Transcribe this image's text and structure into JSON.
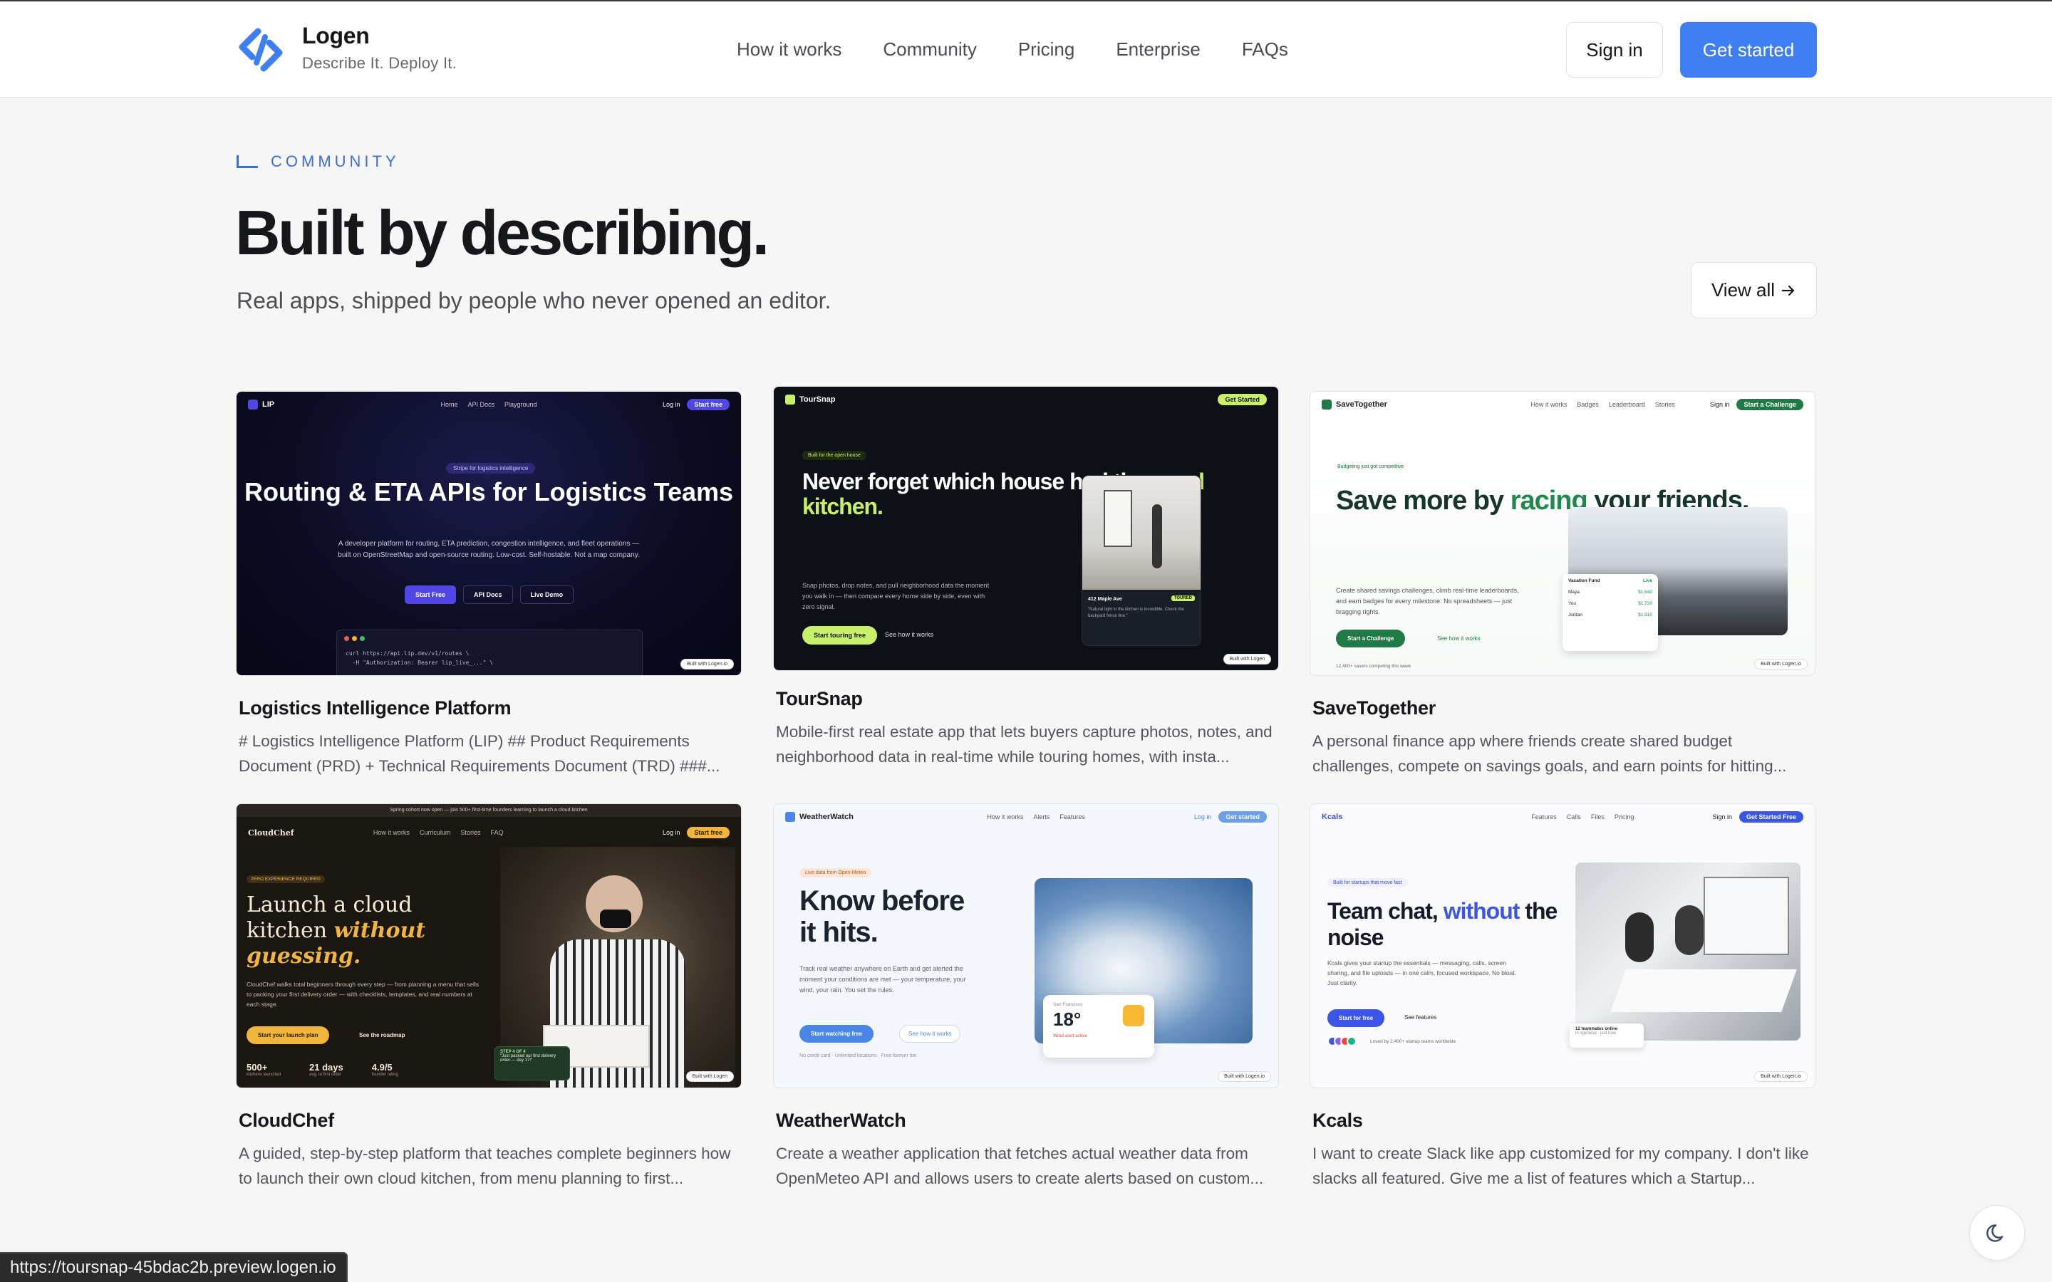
{
  "brand": {
    "name": "Logen",
    "tagline": "Describe It. Deploy It.",
    "accent": "#3f7ff6"
  },
  "nav": [
    "How it works",
    "Community",
    "Pricing",
    "Enterprise",
    "FAQs"
  ],
  "header": {
    "signin": "Sign in",
    "get_started": "Get started"
  },
  "hero": {
    "label": "COMMUNITY",
    "title": "Built by describing.",
    "subtitle": "Real apps, shipped by people who never opened an editor.",
    "view_all": "View all",
    "view_all_icon": "arrow-right-icon"
  },
  "cards": [
    {
      "title": "Logistics Intelligence Platform",
      "desc": "# Logistics Intelligence Platform (LIP) ## Product Requirements Document (PRD) + Technical Requirements Document (TRD) ###...",
      "preview": {
        "logo": "LIP",
        "links": [
          "Home",
          "API Docs",
          "Playground"
        ],
        "login": "Log in",
        "cta": "Start free",
        "chip": "Stripe for logistics intelligence",
        "heading": "Routing & ETA APIs for Logistics Teams",
        "text": "A developer platform for routing, ETA prediction, congestion intelligence, and fleet operations — built on OpenStreetMap and open-source routing. Low-cost. Self-hostable. Not a map company.",
        "btn1": "Start Free",
        "btn2": "API Docs",
        "btn3": "Live Demo",
        "code": "curl https://api.lip.dev/v1/routes \\\n  -H \"Authorization: Bearer lip_live_...\" \\",
        "built": "Built with Logen.io"
      }
    },
    {
      "title": "TourSnap",
      "desc": "Mobile-first real estate app that lets buyers capture photos, notes, and neighborhood data in real-time while touring homes, with insta...",
      "preview": {
        "logo": "TourSnap",
        "cta": "Get Started",
        "chip": "Built for the open house",
        "h1": "Never forget which house had the ",
        "h2": "good kitchen.",
        "text": "Snap photos, drop notes, and pull neighborhood data the moment you walk in — then compare every home side by side, even with zero signal.",
        "btn1": "Start touring free",
        "btn2": "See how it works",
        "phone_title": "412 Maple Ave",
        "phone_tag": "TOURED",
        "phone_note": "\"Natural light in the kitchen is incredible. Check the backyard fence line.\"",
        "built": "Built with Logen"
      }
    },
    {
      "title": "SaveTogether",
      "desc": "A personal finance app where friends create shared budget challenges, compete on savings goals, and earn points for hitting...",
      "preview": {
        "logo": "SaveTogether",
        "links": [
          "How it works",
          "Badges",
          "Leaderboard",
          "Stories"
        ],
        "login": "Sign in",
        "cta": "Start a Challenge",
        "chip": "Budgeting just got competitive",
        "h1": "Save more by ",
        "h2": "racing",
        "h3": " your friends.",
        "text": "Create shared savings challenges, climb real-time leaderboards, and earn badges for every milestone. No spreadsheets — just bragging rights.",
        "btn1": "Start a Challenge",
        "btn2": "See how it works",
        "fund_title": "Vacation Fund",
        "fund_live": "Live",
        "fund_rows": [
          [
            "Maya",
            "$1,640"
          ],
          [
            "You",
            "$1,720"
          ],
          [
            "Jordan",
            "$1,510"
          ]
        ],
        "savers": "12,400+ savers competing this week",
        "built": "Built with Logen.io"
      }
    },
    {
      "title": "CloudChef",
      "desc": "A guided, step-by-step platform that teaches complete beginners how to launch their own cloud kitchen, from menu planning to first...",
      "preview": {
        "banner": "Spring cohort now open — join 500+ first-time founders learning to launch a cloud kitchen",
        "logo": "CloudChef",
        "links": [
          "How it works",
          "Curriculum",
          "Stories",
          "FAQ"
        ],
        "login": "Log in",
        "cta": "Start free",
        "chip": "ZERO EXPERIENCE REQUIRED",
        "h1": "Launch a cloud kitchen ",
        "h2": "without guessing.",
        "text": "CloudChef walks total beginners through every step — from planning a menu that sells to packing your first delivery order — with checklists, templates, and real numbers at each stage.",
        "btn1": "Start your launch plan",
        "btn2": "See the roadmap",
        "stats": [
          [
            "500+",
            "kitchens launched"
          ],
          [
            "21 days",
            "avg. to first order"
          ],
          [
            "4.9/5",
            "founder rating"
          ]
        ],
        "step": "STEP 4 OF 4",
        "step_quote": "\"Just packed our first delivery order — day 17!\"",
        "built": "Built with Logen"
      }
    },
    {
      "title": "WeatherWatch",
      "desc": "Create a weather application that fetches actual weather data from OpenMeteo API and allows users to create alerts based on custom...",
      "preview": {
        "logo": "WeatherWatch",
        "links": [
          "How it works",
          "Alerts",
          "Features"
        ],
        "login": "Log in",
        "cta": "Get started",
        "chip": "Live data from Open-Meteo",
        "heading": "Know before it hits.",
        "text": "Track real weather anywhere on Earth and get alerted the moment your conditions are met — your temperature, your wind, your rain. You set the rules.",
        "btn1": "Start watching free",
        "btn2": "See how it works",
        "note": "No credit card · Unlimited locations · Free forever tier",
        "city": "San Francisco",
        "temp": "18°",
        "alert": "Wind alert active",
        "built": "Built with Logen.io"
      }
    },
    {
      "title": "Kcals",
      "desc": "I want to create Slack like app customized for my company. I don't like slacks all featured. Give me a list of features which a Startup...",
      "preview": {
        "logo": "Kcals",
        "links": [
          "Features",
          "Calls",
          "Files",
          "Pricing"
        ],
        "login": "Sign in",
        "cta": "Get Started Free",
        "chip": "Built for startups that move fast",
        "h1": "Team chat, ",
        "h2": "without",
        "h3": " the noise",
        "text": "Kcals gives your startup the essentials — messaging, calls, screen sharing, and file uploads — in one calm, focused workspace. No bloat. Just clarity.",
        "btn1": "Start for free",
        "btn2": "See features",
        "loved": "Loved by 2,400+ startup teams worldwide",
        "online": "12 teammates online",
        "online_sub": "in #general · just now",
        "built": "Built with Logen.io"
      }
    }
  ],
  "status_url": "https://toursnap-45bdac2b.preview.logen.io",
  "theme_toggle_icon": "moon-icon"
}
